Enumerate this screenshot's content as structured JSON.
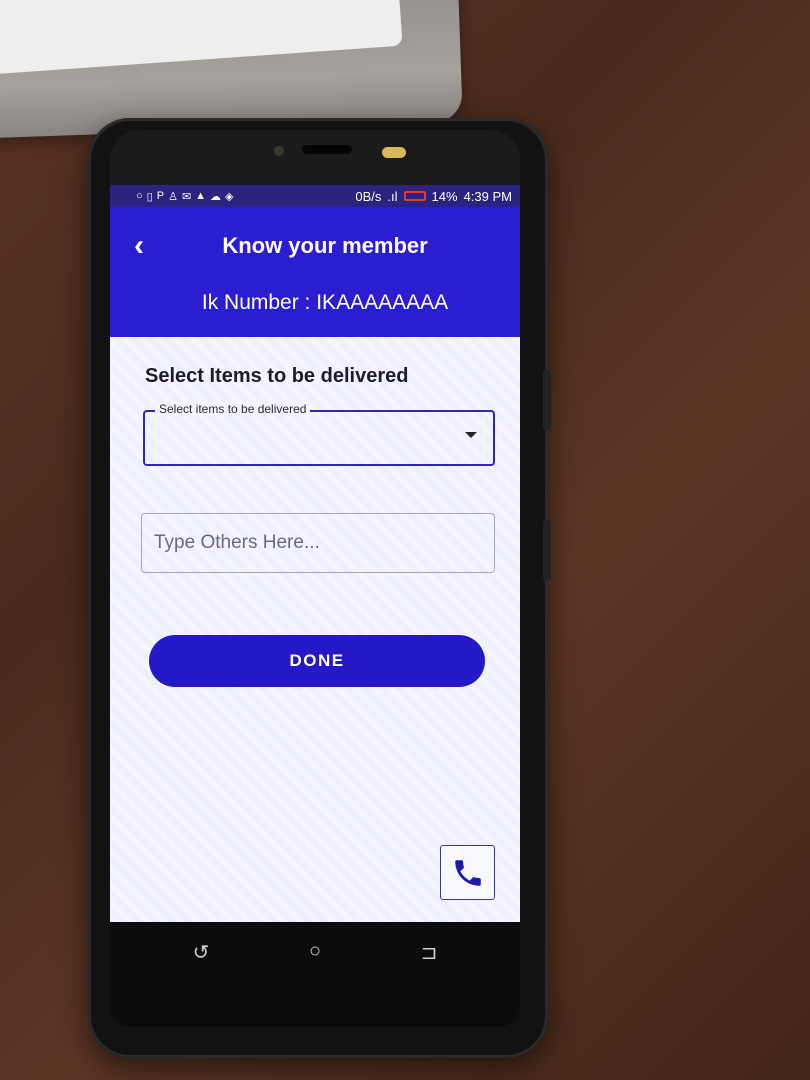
{
  "status_bar": {
    "network_speed": "0B/s",
    "battery": "14%",
    "time": "4:39 PM"
  },
  "header": {
    "title": "Know your member",
    "ik_number": "Ik Number : IKAAAAAAAA"
  },
  "form": {
    "section_title": "Select Items to be delivered",
    "dropdown_label": "Select items to be delivered",
    "others_placeholder": "Type Others Here...",
    "done_label": "DONE"
  },
  "colors": {
    "primary": "#2a1ed0",
    "button": "#2518c6",
    "call_icon": "#1e1aa8"
  },
  "icons": {
    "back": "back-arrow-icon",
    "dropdown": "chevron-down-icon",
    "call": "phone-icon"
  }
}
